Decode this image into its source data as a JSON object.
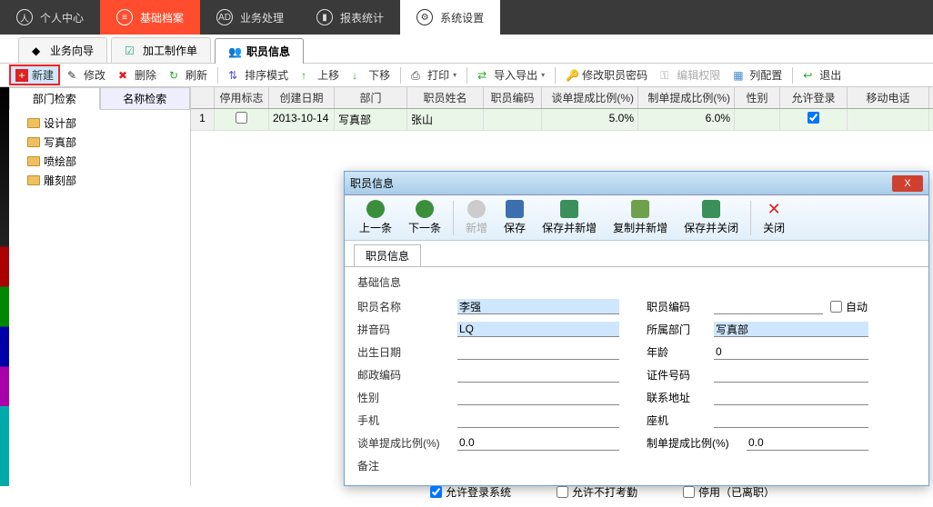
{
  "topnav": [
    {
      "icon": "user",
      "label": "个人中心"
    },
    {
      "icon": "list",
      "label": "基础档案",
      "active": true
    },
    {
      "icon": "task",
      "label": "业务处理"
    },
    {
      "icon": "chart",
      "label": "报表统计"
    },
    {
      "icon": "gear",
      "label": "系统设置"
    }
  ],
  "doctabs": [
    {
      "label": "业务向导"
    },
    {
      "label": "加工制作单"
    },
    {
      "label": "职员信息",
      "active": true
    }
  ],
  "toolbar": {
    "new": "新建",
    "edit": "修改",
    "del": "删除",
    "refresh": "刷新",
    "sort": "排序模式",
    "up": "上移",
    "down": "下移",
    "print": "打印",
    "io": "导入导出",
    "pwd": "修改职员密码",
    "perm": "编辑权限",
    "cols": "列配置",
    "exit": "退出"
  },
  "subtabs": {
    "dept": "部门检索",
    "name": "名称检索"
  },
  "tree": [
    "设计部",
    "写真部",
    "喷绘部",
    "雕刻部"
  ],
  "grid": {
    "headers": [
      "",
      "停用标志",
      "创建日期",
      "部门",
      "职员姓名",
      "职员编码",
      "谈单提成比例(%)",
      "制单提成比例(%)",
      "性别",
      "允许登录",
      "移动电话"
    ],
    "row": {
      "num": "1",
      "stop": "",
      "date": "2013-10-14",
      "dept": "写真部",
      "name": "张山",
      "code": "",
      "talk": "5.0%",
      "make": "6.0%",
      "sex": "",
      "login": true
    }
  },
  "dialog": {
    "title": "职员信息",
    "tb": {
      "prev": "上一条",
      "next": "下一条",
      "add": "新增",
      "save": "保存",
      "saveNew": "保存并新增",
      "copyNew": "复制并新增",
      "saveClose": "保存并关闭",
      "close": "关闭"
    },
    "tab": "职员信息",
    "section": "基础信息",
    "fields": {
      "name_l": "职员名称",
      "name_v": "李强",
      "code_l": "职员编码",
      "code_v": "",
      "auto": "自动",
      "py_l": "拼音码",
      "py_v": "LQ",
      "dept_l": "所属部门",
      "dept_v": "写真部",
      "birth_l": "出生日期",
      "birth_v": "",
      "age_l": "年龄",
      "age_v": "0",
      "post_l": "邮政编码",
      "post_v": "",
      "id_l": "证件号码",
      "id_v": "",
      "sex_l": "性别",
      "sex_v": "",
      "addr_l": "联系地址",
      "addr_v": "",
      "mob_l": "手机",
      "mob_v": "",
      "tel_l": "座机",
      "tel_v": "",
      "talk_l": "谈单提成比例(%)",
      "talk_v": "0.0",
      "make_l": "制单提成比例(%)",
      "make_v": "0.0",
      "note_l": "备注"
    },
    "checks": {
      "login": "允许登录系统",
      "nokq": "允许不打考勤",
      "stop": "停用（已离职）"
    }
  }
}
